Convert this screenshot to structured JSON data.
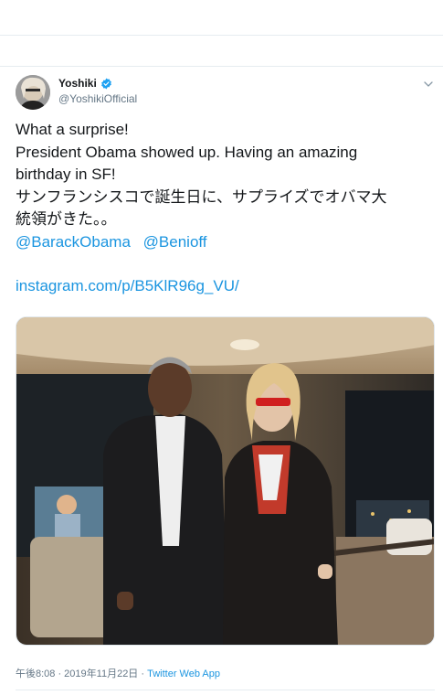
{
  "tweet": {
    "author": {
      "name": "Yoshiki",
      "handle": "@YoshikiOfficial",
      "verified": true
    },
    "text_lines": [
      "What a surprise!",
      "President Obama showed up. Having an amazing",
      "birthday in SF!",
      "サンフランシスコで誕生日に、サプライズでオバマ大",
      "統領がきた。。"
    ],
    "mentions": [
      "@BarackObama",
      "@Benioff"
    ],
    "link": "instagram.com/p/B5KlR96g_VU/",
    "timestamp": "午後8:08 · 2019年11月22日",
    "separator": " · ",
    "source": "Twitter Web App"
  },
  "icons": {
    "verified": "verified-badge-icon",
    "menu": "chevron-down-icon"
  },
  "colors": {
    "link": "#1b95e0",
    "secondary_text": "#657786",
    "primary_text": "#14171a",
    "divider": "#e6ecf0"
  }
}
